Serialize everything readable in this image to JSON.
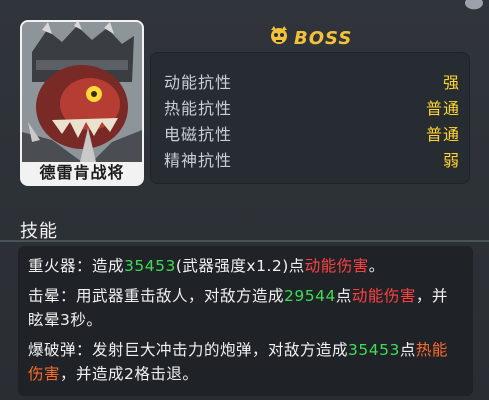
{
  "boss": {
    "label": "BOSS"
  },
  "portrait": {
    "name": "德雷肯战将"
  },
  "resistances": [
    {
      "label": "动能抗性",
      "value": "强"
    },
    {
      "label": "热能抗性",
      "value": "普通"
    },
    {
      "label": "电磁抗性",
      "value": "普通"
    },
    {
      "label": "精神抗性",
      "value": "弱"
    }
  ],
  "skills": {
    "title": "技能",
    "items": [
      {
        "name": "重火器",
        "sep": "：",
        "t1": "造成",
        "n1": "35453",
        "t2": "(武器强度x1.2)点",
        "dmg": "动能伤害",
        "t3": "。"
      },
      {
        "name": "击晕",
        "sep": "：",
        "t1": "用武器重击敌人，对敌方造成",
        "n1": "29544",
        "t2": "点",
        "dmg": "动能伤害",
        "t3": "，并眩晕3秒。"
      },
      {
        "name": "爆破弹",
        "sep": "：",
        "t1": "发射巨大冲击力的炮弹，对敌方造成",
        "n1": "35453",
        "t2": "点",
        "dmg": "热能伤害",
        "t3": "，并造成2格击退。"
      }
    ]
  },
  "colors": {
    "boss": "#f3c23a",
    "value": "#ffd530",
    "number": "#3fdc55",
    "kinetic": "#ff4040",
    "thermal": "#ff6a2a"
  }
}
